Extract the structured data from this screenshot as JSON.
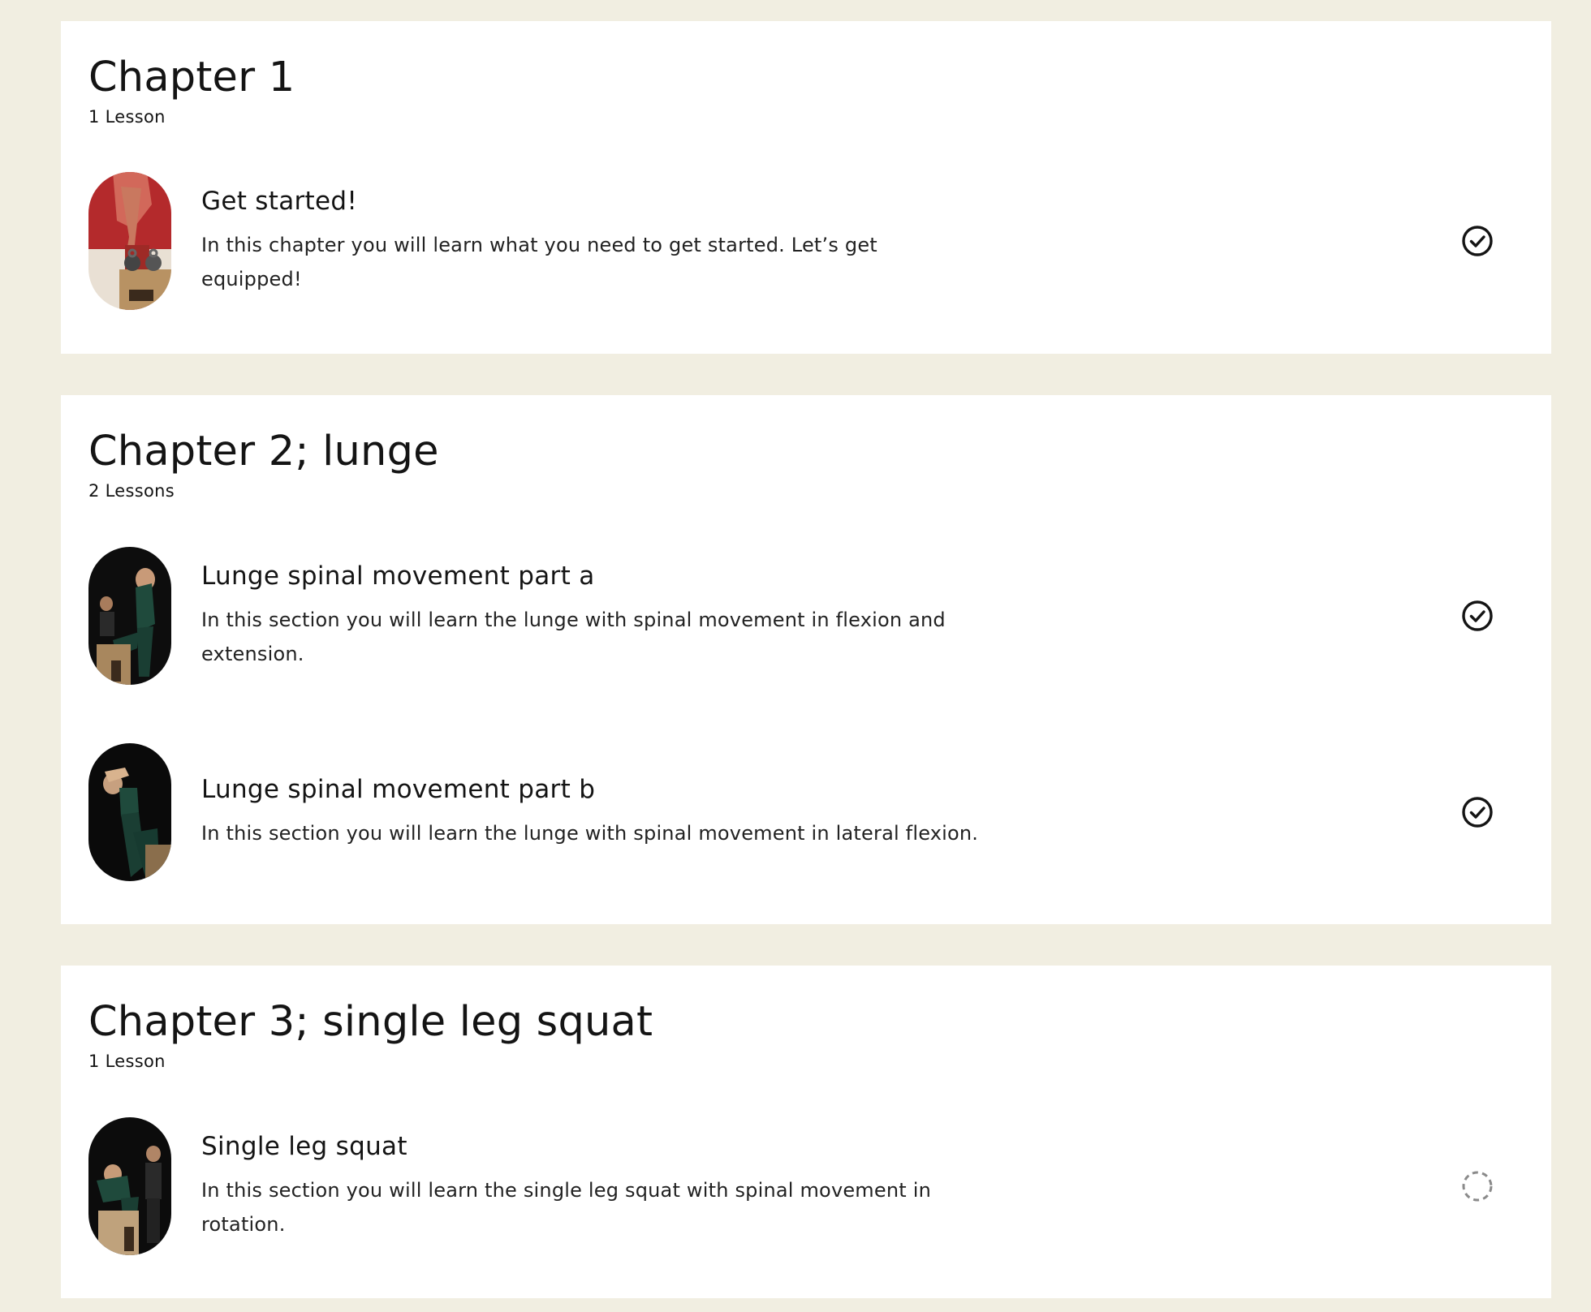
{
  "colors": {
    "background": "#f1eee1",
    "card": "#ffffff",
    "text": "#141414",
    "status_done": "#141414",
    "status_pending": "#8a8a8a"
  },
  "chapters": [
    {
      "title": "Chapter 1",
      "count": "1 Lesson",
      "lessons": [
        {
          "title": "Get started!",
          "desc_line1": "In this chapter you will learn what you need to get started. Let’s get",
          "desc_line2": "equipped!",
          "status": "completed",
          "status_icon": "check-circle-icon",
          "thumbnail": "kettlebell-lesson-thumbnail"
        }
      ]
    },
    {
      "title": "Chapter 2; lunge",
      "count": "2 Lessons",
      "lessons": [
        {
          "title": "Lunge spinal movement part a",
          "desc_line1": "In this section you will learn the lunge with spinal movement in flexion and",
          "desc_line2": "extension.",
          "status": "completed",
          "status_icon": "check-circle-icon",
          "thumbnail": "lunge-flexion-thumbnail"
        },
        {
          "title": "Lunge spinal movement part b",
          "desc_line1": "In this section you will learn the lunge with spinal movement in lateral flexion.",
          "desc_line2": "",
          "status": "completed",
          "status_icon": "check-circle-icon",
          "thumbnail": "lunge-lateral-thumbnail"
        }
      ]
    },
    {
      "title": "Chapter 3; single leg squat",
      "count": "1 Lesson",
      "lessons": [
        {
          "title": "Single leg squat",
          "desc_line1": "In this section you will learn the single leg squat with spinal movement in",
          "desc_line2": "rotation.",
          "status": "not-started",
          "status_icon": "dashed-circle-icon",
          "thumbnail": "single-leg-squat-thumbnail"
        }
      ]
    }
  ]
}
